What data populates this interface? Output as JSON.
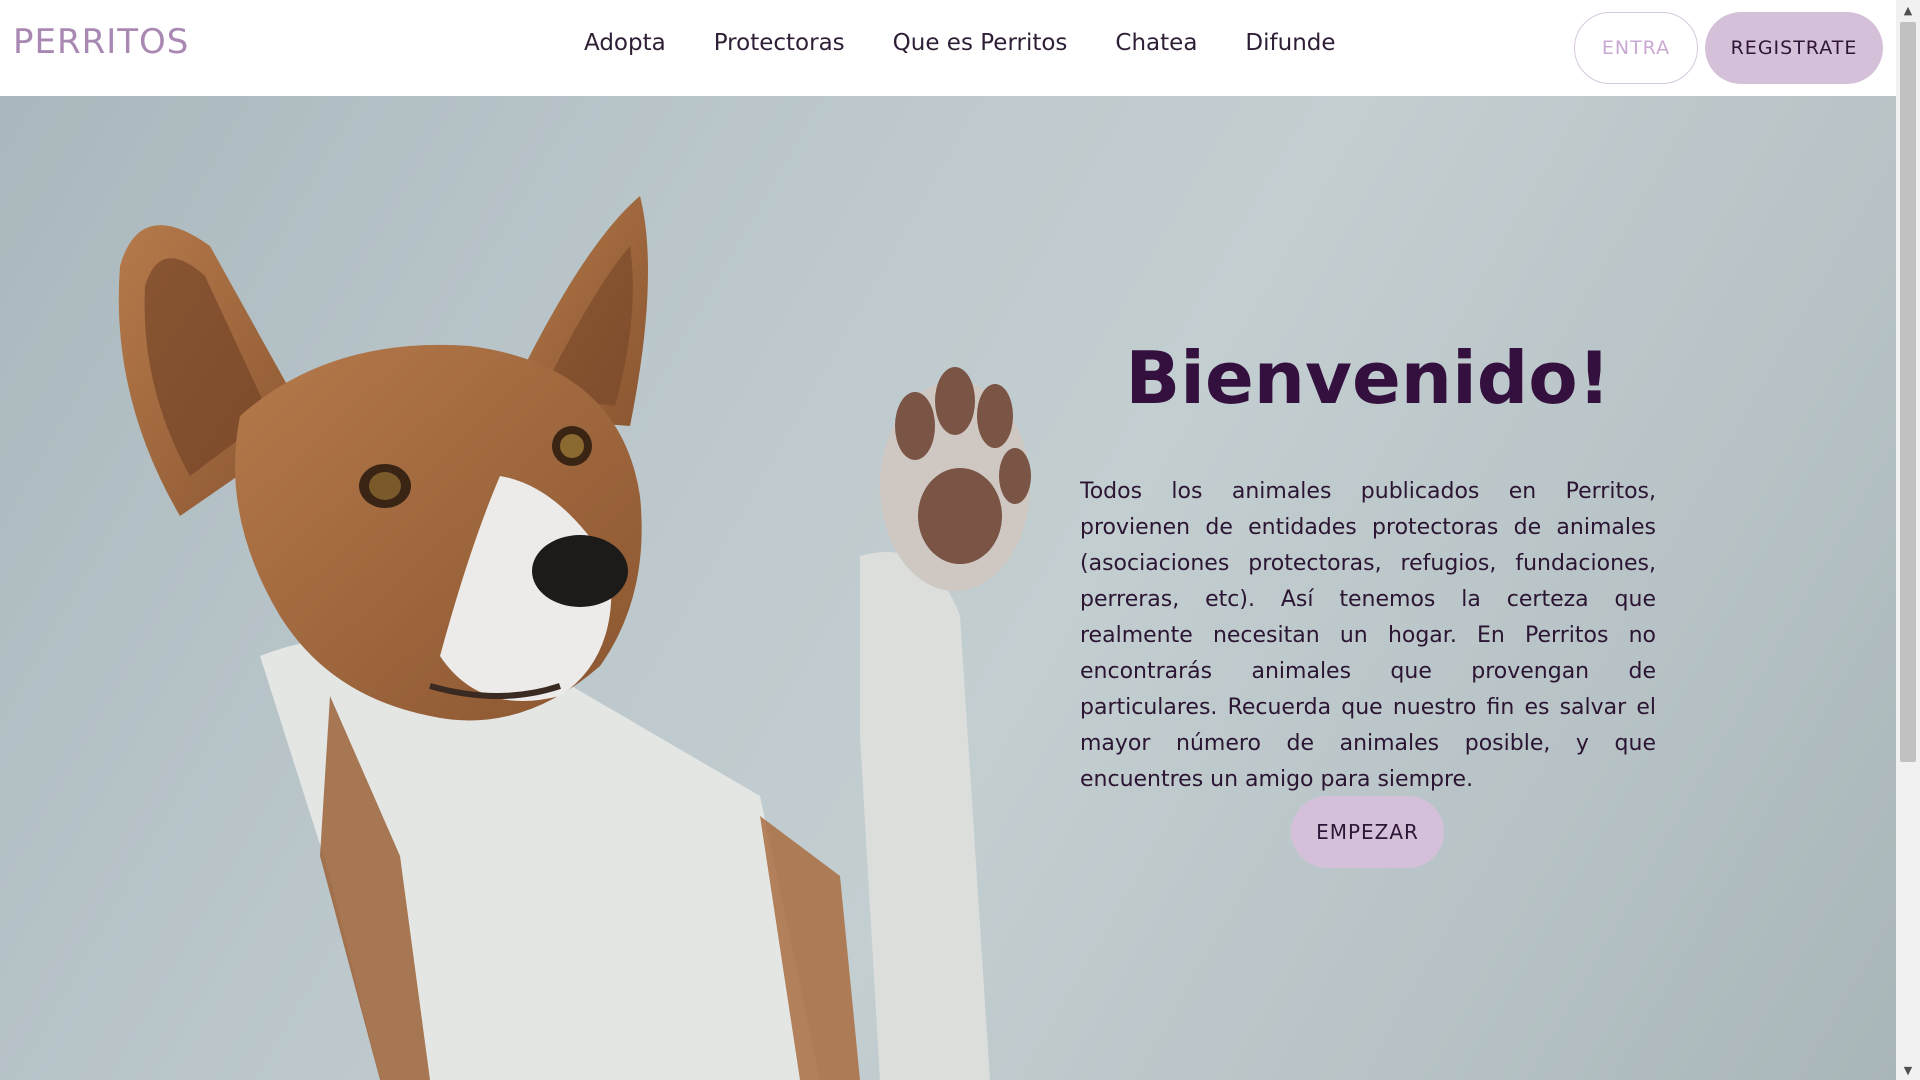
{
  "header": {
    "logo": "PERRITOS",
    "nav": [
      "Adopta",
      "Protectoras",
      "Que es Perritos",
      "Chatea",
      "Difunde"
    ],
    "login_label": "ENTRA",
    "register_label": "REGISTRATE"
  },
  "hero": {
    "title": "Bienvenido!",
    "description": "Todos los animales publicados en Perritos, provienen de entidades protectoras de animales (asociaciones protectoras, refugios, fundaciones, perreras, etc). Así tenemos la certeza que realmente necesitan un hogar. En Perritos no encontrarás animales que provengan de particulares. Recuerda que nuestro fin es salvar el mayor número de animales posible, y que encuentres un amigo para siempre.",
    "cta_label": "EMPEZAR",
    "image_subject": "dog-waving-paw-photo"
  },
  "colors": {
    "accent": "#d5c0da",
    "logo": "#a989b3",
    "title": "#34103f",
    "text": "#2b1533"
  },
  "icons": [
    "scroll-up-arrow-icon",
    "scroll-down-arrow-icon"
  ]
}
